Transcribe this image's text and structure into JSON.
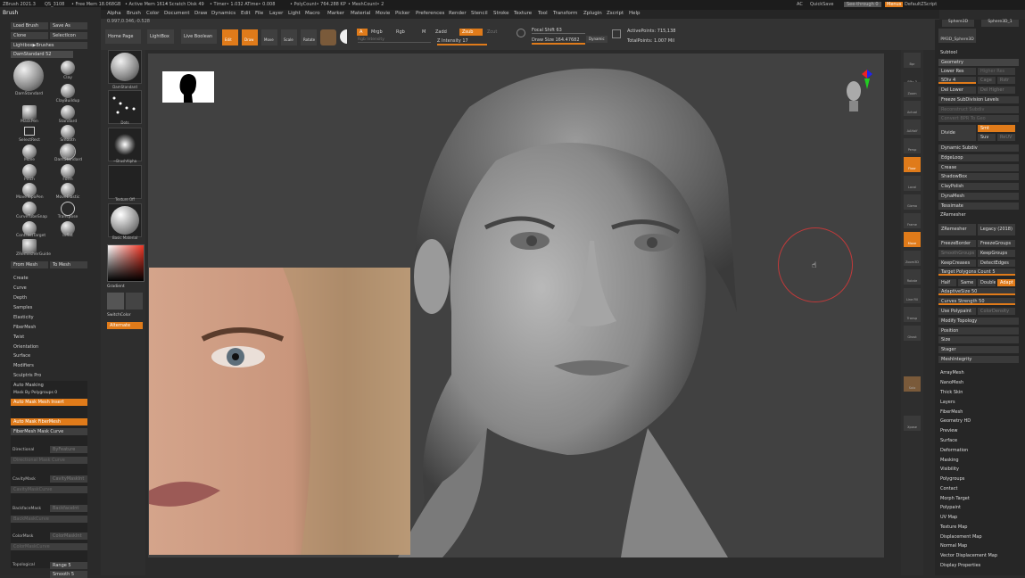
{
  "title_bar": {
    "app": "ZBrush 2021.3",
    "items": [
      "QS_3108",
      "• Free Mem 18.068GB",
      "• Active Mem 1614",
      "• Scratch Disk 49",
      "• Timer• 1.032 ATime• 0.008",
      "• PolyCount• 764.288 KP",
      "• MeshCount• 2"
    ],
    "right": [
      "AC",
      "QuickSave",
      "See-through 0",
      "Menus",
      "DefaultZScript"
    ]
  },
  "menu": [
    "Alpha",
    "Brush",
    "Color",
    "Document",
    "Draw",
    "Dynamics",
    "Edit",
    "File",
    "Layer",
    "Light",
    "Macro",
    "Marker",
    "Material",
    "Movie",
    "Picker",
    "Preferences",
    "Render",
    "Stencil",
    "Stroke",
    "Texture",
    "Tool",
    "Transform",
    "Zplugin",
    "Zscript",
    "Help"
  ],
  "coords": "0.997,0.346,-0.528",
  "left_panel": {
    "header": "Brush",
    "buttons": [
      "Load Brush",
      "Save As",
      "Clone",
      "SelectIcon",
      "Lightbox▶Brushes"
    ],
    "current": "DamStandard",
    "current_val": "52",
    "brushes": [
      "DamStandard",
      "Clay",
      "ClayBuildup",
      "MaskPen",
      "Standard",
      "SelectRect",
      "Smooth",
      "Move",
      "DamStandard",
      "Pinch",
      "Form",
      "MoveTopoPen",
      "MoveElastic",
      "CurveTubeSnap",
      "Transpose",
      "ContrastTarget",
      "Inflat",
      "ZRemesherGuide"
    ],
    "from_mesh": "From Mesh",
    "to_mesh": "To Mesh",
    "sections": [
      "Create",
      "Curve",
      "Depth",
      "Samples",
      "Elasticity",
      "FiberMesh",
      "Twist",
      "Orientation",
      "Surface",
      "Modifiers",
      "Sculptris Pro"
    ],
    "auto_masking": "Auto Masking",
    "mask_by_poly": "Mask By Polygroups 0",
    "auto_mask_insert": "Auto Mask Mesh Insert",
    "auto_mask_fiber": "Auto Mask FiberMesh",
    "fiber_mask_curve": "FiberMesh Mask Curve",
    "directional": "Directional",
    "by_feature": "ByFeature",
    "directional_curve": "Directional Mask Curve",
    "cavity_mask": "CavityMask",
    "cavity_int": "CavityMaskInt",
    "cavity_curve": "CavityMaskCurve",
    "backface_mask": "BackfaceMask",
    "backface_int": "BackfaceInt",
    "backface_curve": "BackMaskCurve",
    "color_mask": "ColorMask",
    "color_mask_int": "ColorMaskInt",
    "color_mask_curve": "ColorMaskCurve",
    "topological": "Topological",
    "range": "Range 5",
    "smooth": "Smooth 5"
  },
  "tiles": [
    "DamStandard",
    "Dots",
    "~BrushAlpha",
    "Texture Off",
    "Basic Material"
  ],
  "gradient": "Gradient",
  "switch_color": "SwitchColor",
  "alternate": "Alternate",
  "toolbar": {
    "home": "Home Page",
    "lightbox": "LightBox",
    "live_boolean": "Live Boolean",
    "modes": [
      "Edit",
      "Draw",
      "Move",
      "Scale",
      "Rotate"
    ],
    "a": "A",
    "mrgb": "Mrgb",
    "rgb": "Rgb",
    "m": "M",
    "zadd": "Zadd",
    "zsub": "Zsub",
    "zcut": "Zcut",
    "rgb_intensity": "Rgb Intensity",
    "z_intensity": "Z Intensity 17",
    "focal": "Focal Shift 63",
    "draw_size": "Draw Size 164.47682",
    "dynamic": "Dynamic",
    "active_points": "ActivePoints: 715,138",
    "total_points": "TotalPoints: 1.007 Mil"
  },
  "right_shelf": [
    "Bpr",
    "SPix 3",
    "Zoom",
    "Actual",
    "AAHalf",
    "Persp",
    "Floor",
    "Local",
    "Gizmo",
    "Frame",
    "Move",
    "Zoom3D",
    "Rotate",
    "Line Fill",
    "Transp",
    "Ghost",
    "Solo",
    "Xpose"
  ],
  "right_panel": {
    "subtools": [
      "Sphere3D",
      "Sphere3D_1",
      "PM3D_Sphere3D"
    ],
    "subtool": "Subtool",
    "geometry": "Geometry",
    "lower_res": "Lower Res",
    "higher_res": "Higher Res",
    "sdiv": "SDiv 4",
    "cage": "Cage",
    "rstr": "Rstr",
    "del_lower": "Del Lower",
    "del_higher": "Del Higher",
    "freeze": "Freeze SubDivision Levels",
    "reconstruct": "Reconstruct Subdiv",
    "convert": "Convert BPR To Geo",
    "divide": "Divide",
    "smt": "Smt",
    "suv": "Suv",
    "reuv": "ReUV",
    "items1": [
      "Dynamic Subdiv",
      "EdgeLoop",
      "Crease",
      "ShadowBox",
      "ClayPolish",
      "DynaMesh",
      "Tessimate"
    ],
    "zremesher": "ZRemesher",
    "zremesher_btn": "ZRemesher",
    "legacy": "Legacy (2018)",
    "freeze_border": "FreezeBorder",
    "freeze_groups": "FreezeGroups",
    "smooth_groups": "SmoothGroups",
    "keep_groups": "KeepGroups",
    "keep_creases": "KeepCreases",
    "detect_edges": "DetectEdges",
    "target_count": "Target Polygons Count 5",
    "half": "Half",
    "same": "Same",
    "double": "Double",
    "adapt": "Adapt",
    "adaptive_size": "AdaptiveSize 50",
    "curves_strength": "Curves Strength 50",
    "use_polypaint": "Use Polypaint",
    "color_density": "ColorDensity",
    "items2": [
      "Modify Topology",
      "Position",
      "Size",
      "Stager",
      "MeshIntegrity"
    ],
    "items3": [
      "ArrayMesh",
      "NanoMesh",
      "Thick Skin",
      "Layers",
      "FiberMesh",
      "Geometry HD",
      "Preview",
      "Surface",
      "Deformation",
      "Masking",
      "Visibility",
      "Polygroups",
      "Contact",
      "Morph Target",
      "Polypaint",
      "UV Map",
      "Texture Map",
      "Displacement Map",
      "Normal Map",
      "Vector Displacement Map",
      "Display Properties"
    ]
  },
  "colors": {
    "accent": "#e07b1a",
    "panel": "#2a2a2a",
    "viewport": "#414141"
  }
}
